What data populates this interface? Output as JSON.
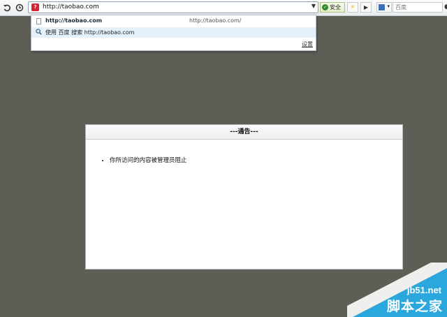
{
  "toolbar": {
    "back_icon": "undo-arrow-icon",
    "history_icon": "clock-icon",
    "address": "http://taobao.com",
    "security_label": "安全",
    "search_placeholder": "百度"
  },
  "dropdown": {
    "items": [
      {
        "icon": "page-icon",
        "title": "http://taobao.com",
        "url": "http://taobao.com/"
      },
      {
        "icon": "search-icon",
        "title": "使用 百度 搜索 http://taobao.com",
        "url": ""
      }
    ],
    "settings_label": "设置"
  },
  "notice": {
    "title": "---通告---",
    "items": [
      "你所访问的内容被管理员阻止"
    ]
  },
  "watermark": {
    "line1": "jb51.net",
    "line2": "脚本之家"
  },
  "colors": {
    "page_background": "#5e5e57",
    "watermark_blue": "#2aa7dc",
    "highlight_row": "#e4f1fb"
  }
}
